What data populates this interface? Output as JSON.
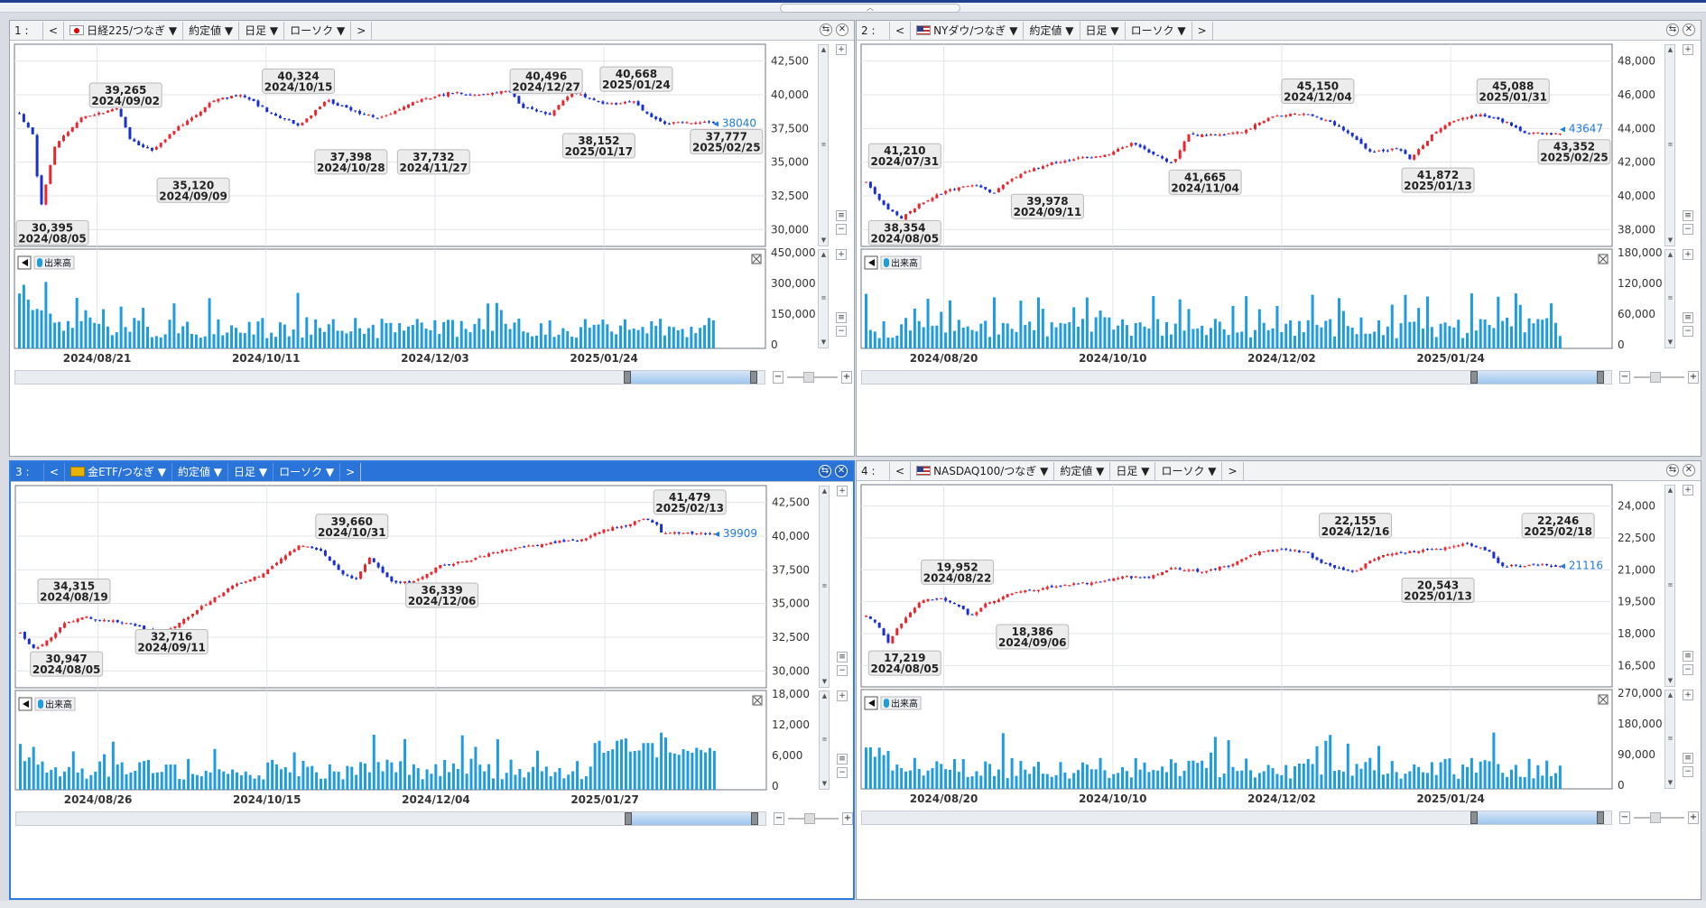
{
  "top_grip": "︿",
  "panels": [
    {
      "num": "1 :",
      "symbol": "日経225/つなぎ ▼",
      "flag": "jp",
      "active": false,
      "price_type": "約定値 ▼",
      "period": "日足 ▼",
      "chart_style": "ローソク ▼",
      "prev": "<",
      "next": ">",
      "volume_label": "出来高",
      "last_price": "◂ 38040",
      "price_axis": [
        "42,500",
        "40,000",
        "37,500",
        "35,000",
        "32,500",
        "30,000"
      ],
      "volume_axis": [
        "450,000",
        "300,000",
        "150,000",
        "0"
      ],
      "date_labels": [
        "2024/08/21",
        "2024/10/11",
        "2024/12/03",
        "2025/01/24"
      ],
      "annotations": [
        {
          "value": "30,395",
          "date": "2024/08/05"
        },
        {
          "value": "39,265",
          "date": "2024/09/02"
        },
        {
          "value": "35,120",
          "date": "2024/09/09"
        },
        {
          "value": "40,324",
          "date": "2024/10/15"
        },
        {
          "value": "37,398",
          "date": "2024/10/28"
        },
        {
          "value": "37,732",
          "date": "2024/11/27"
        },
        {
          "value": "40,496",
          "date": "2024/12/27"
        },
        {
          "value": "38,152",
          "date": "2025/01/17"
        },
        {
          "value": "40,668",
          "date": "2025/01/24"
        },
        {
          "value": "37,777",
          "date": "2025/02/25"
        }
      ]
    },
    {
      "num": "2 :",
      "symbol": "NYダウ/つなぎ ▼",
      "flag": "us",
      "active": false,
      "price_type": "約定値 ▼",
      "period": "日足 ▼",
      "chart_style": "ローソク ▼",
      "prev": "<",
      "next": ">",
      "volume_label": "出来高",
      "last_price": "◂ 43647",
      "price_axis": [
        "48,000",
        "46,000",
        "44,000",
        "42,000",
        "40,000",
        "38,000"
      ],
      "volume_axis": [
        "180,000",
        "120,000",
        "60,000",
        "0"
      ],
      "date_labels": [
        "2024/08/20",
        "2024/10/10",
        "2024/12/02",
        "2025/01/24"
      ],
      "annotations": [
        {
          "value": "41,210",
          "date": "2024/07/31"
        },
        {
          "value": "38,354",
          "date": "2024/08/05"
        },
        {
          "value": "39,978",
          "date": "2024/09/11"
        },
        {
          "value": "41,665",
          "date": "2024/11/04"
        },
        {
          "value": "45,150",
          "date": "2024/12/04"
        },
        {
          "value": "41,872",
          "date": "2025/01/13"
        },
        {
          "value": "45,088",
          "date": "2025/01/31"
        },
        {
          "value": "43,352",
          "date": "2025/02/25"
        }
      ]
    },
    {
      "num": "3 :",
      "symbol": "金ETF/つなぎ ▼",
      "flag": "gold",
      "active": true,
      "price_type": "約定値 ▼",
      "period": "日足 ▼",
      "chart_style": "ローソク ▼",
      "prev": "<",
      "next": ">",
      "volume_label": "出来高",
      "last_price": "◂ 39909",
      "price_axis": [
        "42,500",
        "40,000",
        "37,500",
        "35,000",
        "32,500",
        "30,000"
      ],
      "volume_axis": [
        "18,000",
        "12,000",
        "6,000",
        "0"
      ],
      "date_labels": [
        "2024/08/26",
        "2024/10/15",
        "2024/12/04",
        "2025/01/27"
      ],
      "annotations": [
        {
          "value": "34,315",
          "date": "2024/08/19"
        },
        {
          "value": "30,947",
          "date": "2024/08/05"
        },
        {
          "value": "32,716",
          "date": "2024/09/11"
        },
        {
          "value": "39,660",
          "date": "2024/10/31"
        },
        {
          "value": "36,339",
          "date": "2024/12/06"
        },
        {
          "value": "41,479",
          "date": "2025/02/13"
        }
      ]
    },
    {
      "num": "4 :",
      "symbol": "NASDAQ100/つなぎ ▼",
      "flag": "us",
      "active": false,
      "price_type": "約定値 ▼",
      "period": "日足 ▼",
      "chart_style": "ローソク ▼",
      "prev": "<",
      "next": ">",
      "volume_label": "出来高",
      "last_price": "◂ 21116",
      "price_axis": [
        "24,000",
        "22,500",
        "21,000",
        "19,500",
        "18,000",
        "16,500"
      ],
      "volume_axis": [
        "270,000",
        "180,000",
        "90,000",
        "0"
      ],
      "date_labels": [
        "2024/08/20",
        "2024/10/10",
        "2024/12/02",
        "2025/01/24"
      ],
      "annotations": [
        {
          "value": "19,952",
          "date": "2024/08/22"
        },
        {
          "value": "17,219",
          "date": "2024/08/05"
        },
        {
          "value": "18,386",
          "date": "2024/09/06"
        },
        {
          "value": "22,155",
          "date": "2024/12/16"
        },
        {
          "value": "20,543",
          "date": "2025/01/13"
        },
        {
          "value": "22,246",
          "date": "2025/02/18"
        }
      ]
    }
  ],
  "colors": {
    "candle_up": "#e8262d",
    "candle_down": "#1a2fd0",
    "volume_bar": "#1f9be0",
    "active_panel": "#2a74d9",
    "last_price": "#1e7ce0"
  }
}
